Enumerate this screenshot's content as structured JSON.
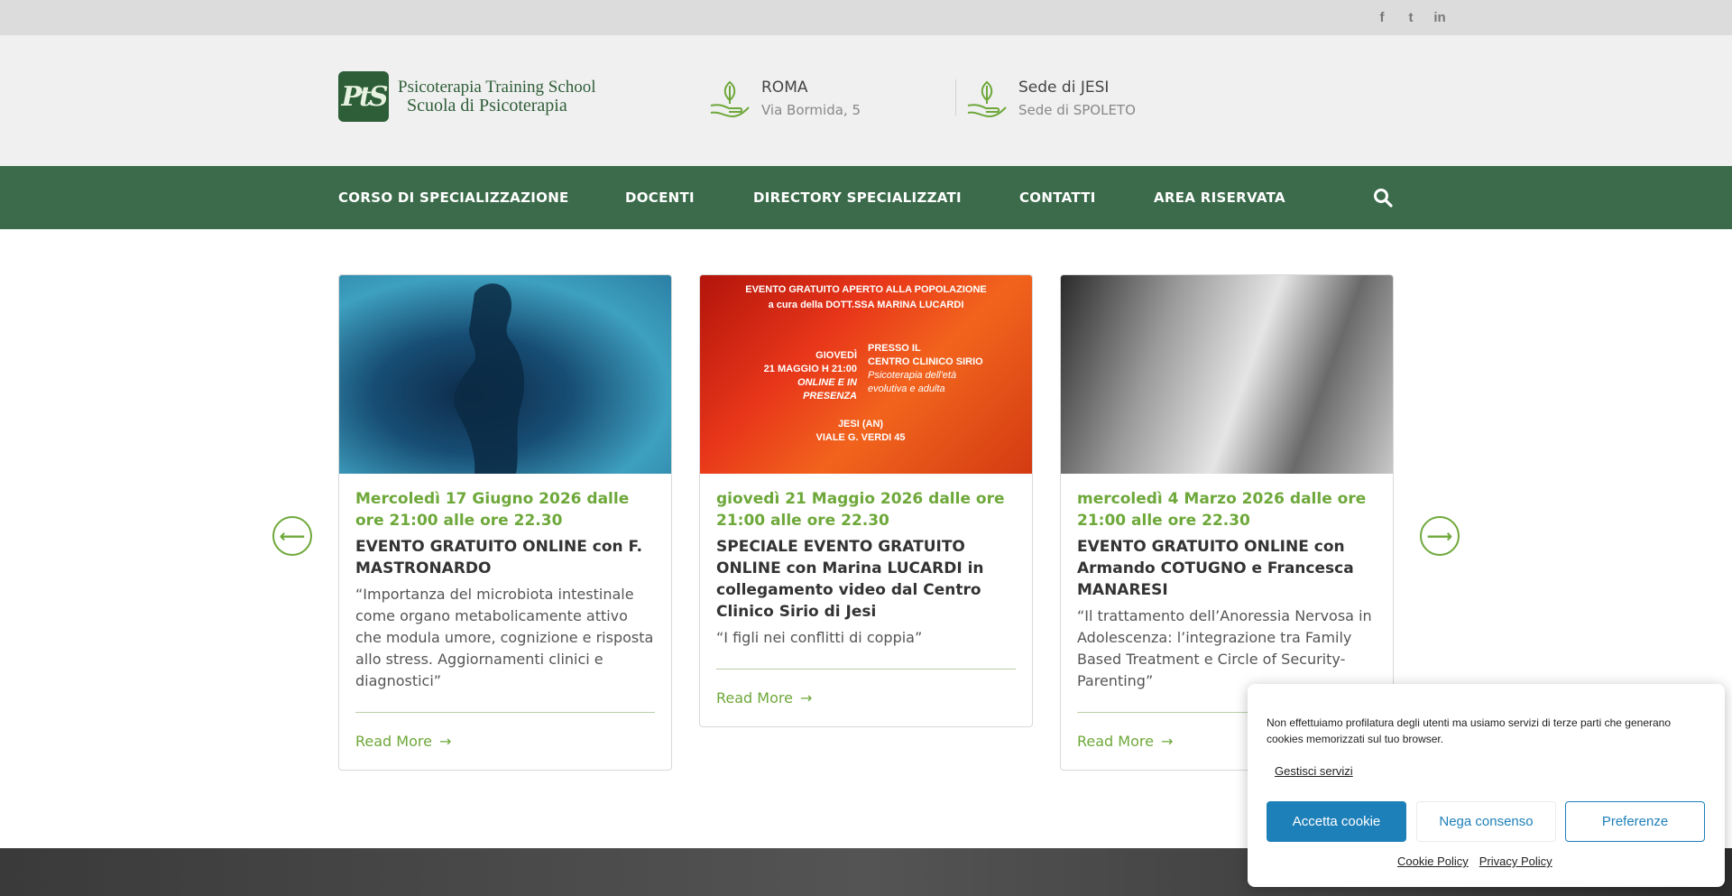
{
  "social": {
    "facebook": "f",
    "twitter": "t",
    "linkedin": "in"
  },
  "logo": {
    "line1": "Psicoterapia Training School",
    "line2": "Scuola di Psicoterapia",
    "mark": "PtS"
  },
  "locations": [
    {
      "title": "ROMA",
      "subtitle": "Via Bormida, 5"
    },
    {
      "title": "Sede di JESI",
      "subtitle": "Sede di SPOLETO"
    }
  ],
  "nav": {
    "items": [
      "CORSO DI SPECIALIZZAZIONE",
      "DOCENTI",
      "DIRECTORY SPECIALIZZATI",
      "CONTATTI",
      "AREA RISERVATA"
    ]
  },
  "cards": [
    {
      "date": "Mercoledì 17 Giugno 2026 dalle ore 21:00 alle ore 22.30",
      "title": "EVENTO GRATUITO ONLINE con F. MASTRONARDO",
      "excerpt": "“Importanza del microbiota intestinale come organo metabolicamente attivo che modula umore, cognizione e risposta allo stress. Aggiornamenti clinici e diagnostici”",
      "more": "Read More"
    },
    {
      "date": "giovedì 21 Maggio 2026 dalle ore 21:00 alle ore 22.30",
      "title": "SPECIALE EVENTO GRATUITO ONLINE con Marina LUCARDI in collegamento video dal Centro Clinico Sirio di Jesi",
      "excerpt": "“I figli nei conflitti di coppia”",
      "more": "Read More",
      "poster": {
        "header1": "EVENTO GRATUITO APERTO ALLA POPOLAZIONE",
        "header2": "a cura della DOTT.SSA MARINA LUCARDI",
        "when1": "GIOVEDÌ",
        "when2": "21 MAGGIO H 21:00",
        "when3": "ONLINE E IN PRESENZA",
        "where1": "PRESSO IL",
        "where2": "CENTRO CLINICO SIRIO",
        "where3": "Psicoterapia dell'età",
        "where4": "evolutiva e adulta",
        "city": "JESI (AN)",
        "street": "VIALE G. VERDI 45"
      }
    },
    {
      "date": "mercoledì 4 Marzo 2026 dalle ore 21:00 alle ore 22.30",
      "title": "EVENTO GRATUITO ONLINE con Armando COTUGNO e Francesca MANARESI",
      "excerpt": "“Il trattamento dell’Anoressia Nervosa in Adolescenza: l’integrazione tra Family Based Treatment e Circle of Security-Parenting”",
      "more": "Read More"
    }
  ],
  "carousel": {
    "prev": "⟵",
    "next": "⟶"
  },
  "cookie": {
    "message": "Non effettuiamo profilatura degli utenti ma usiamo servizi di terze parti  che generano cookies memorizzati sul tuo browser.",
    "manage": "Gestisci servizi",
    "accept": "Accetta cookie",
    "deny": "Nega consenso",
    "preferences": "Preferenze",
    "cookie_policy": "Cookie Policy",
    "privacy_policy": "Privacy Policy"
  },
  "colors": {
    "nav_green": "#3b6b4a",
    "accent_green": "#6ea83a",
    "cookie_blue": "#1e80b9"
  }
}
